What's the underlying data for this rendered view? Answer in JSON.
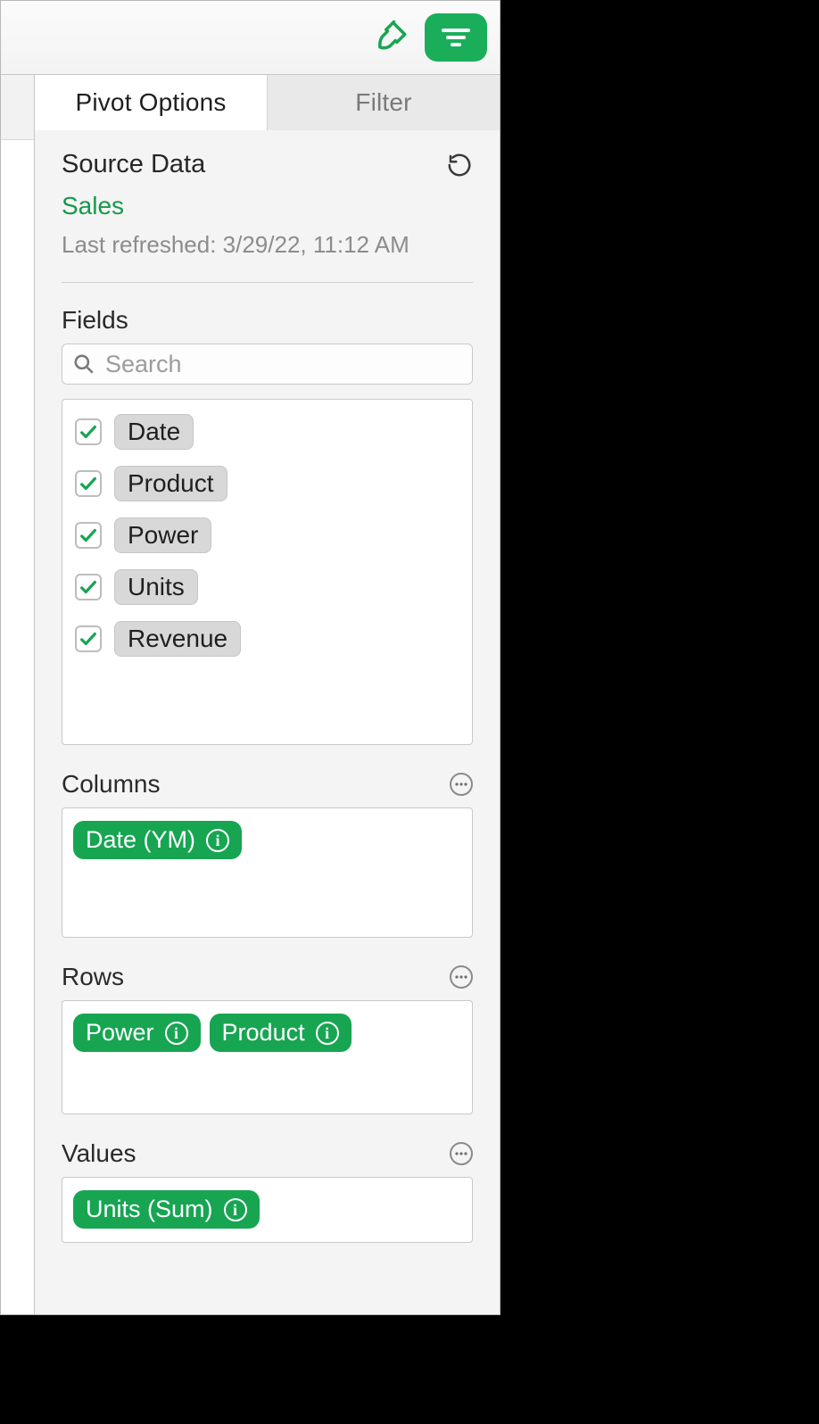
{
  "tabs": {
    "pivot": "Pivot Options",
    "filter": "Filter"
  },
  "source": {
    "heading": "Source Data",
    "link": "Sales",
    "sub": "Last refreshed: 3/29/22, 11:12 AM"
  },
  "fields": {
    "heading": "Fields",
    "search_placeholder": "Search",
    "items": [
      {
        "label": "Date",
        "checked": true
      },
      {
        "label": "Product",
        "checked": true
      },
      {
        "label": "Power",
        "checked": true
      },
      {
        "label": "Units",
        "checked": true
      },
      {
        "label": "Revenue",
        "checked": true
      }
    ]
  },
  "columns": {
    "heading": "Columns",
    "pills": [
      {
        "label": "Date (YM)"
      }
    ]
  },
  "rows": {
    "heading": "Rows",
    "pills": [
      {
        "label": "Power"
      },
      {
        "label": "Product"
      }
    ]
  },
  "values": {
    "heading": "Values",
    "pills": [
      {
        "label": "Units (Sum)"
      }
    ]
  },
  "colors": {
    "accent": "#17a552"
  }
}
